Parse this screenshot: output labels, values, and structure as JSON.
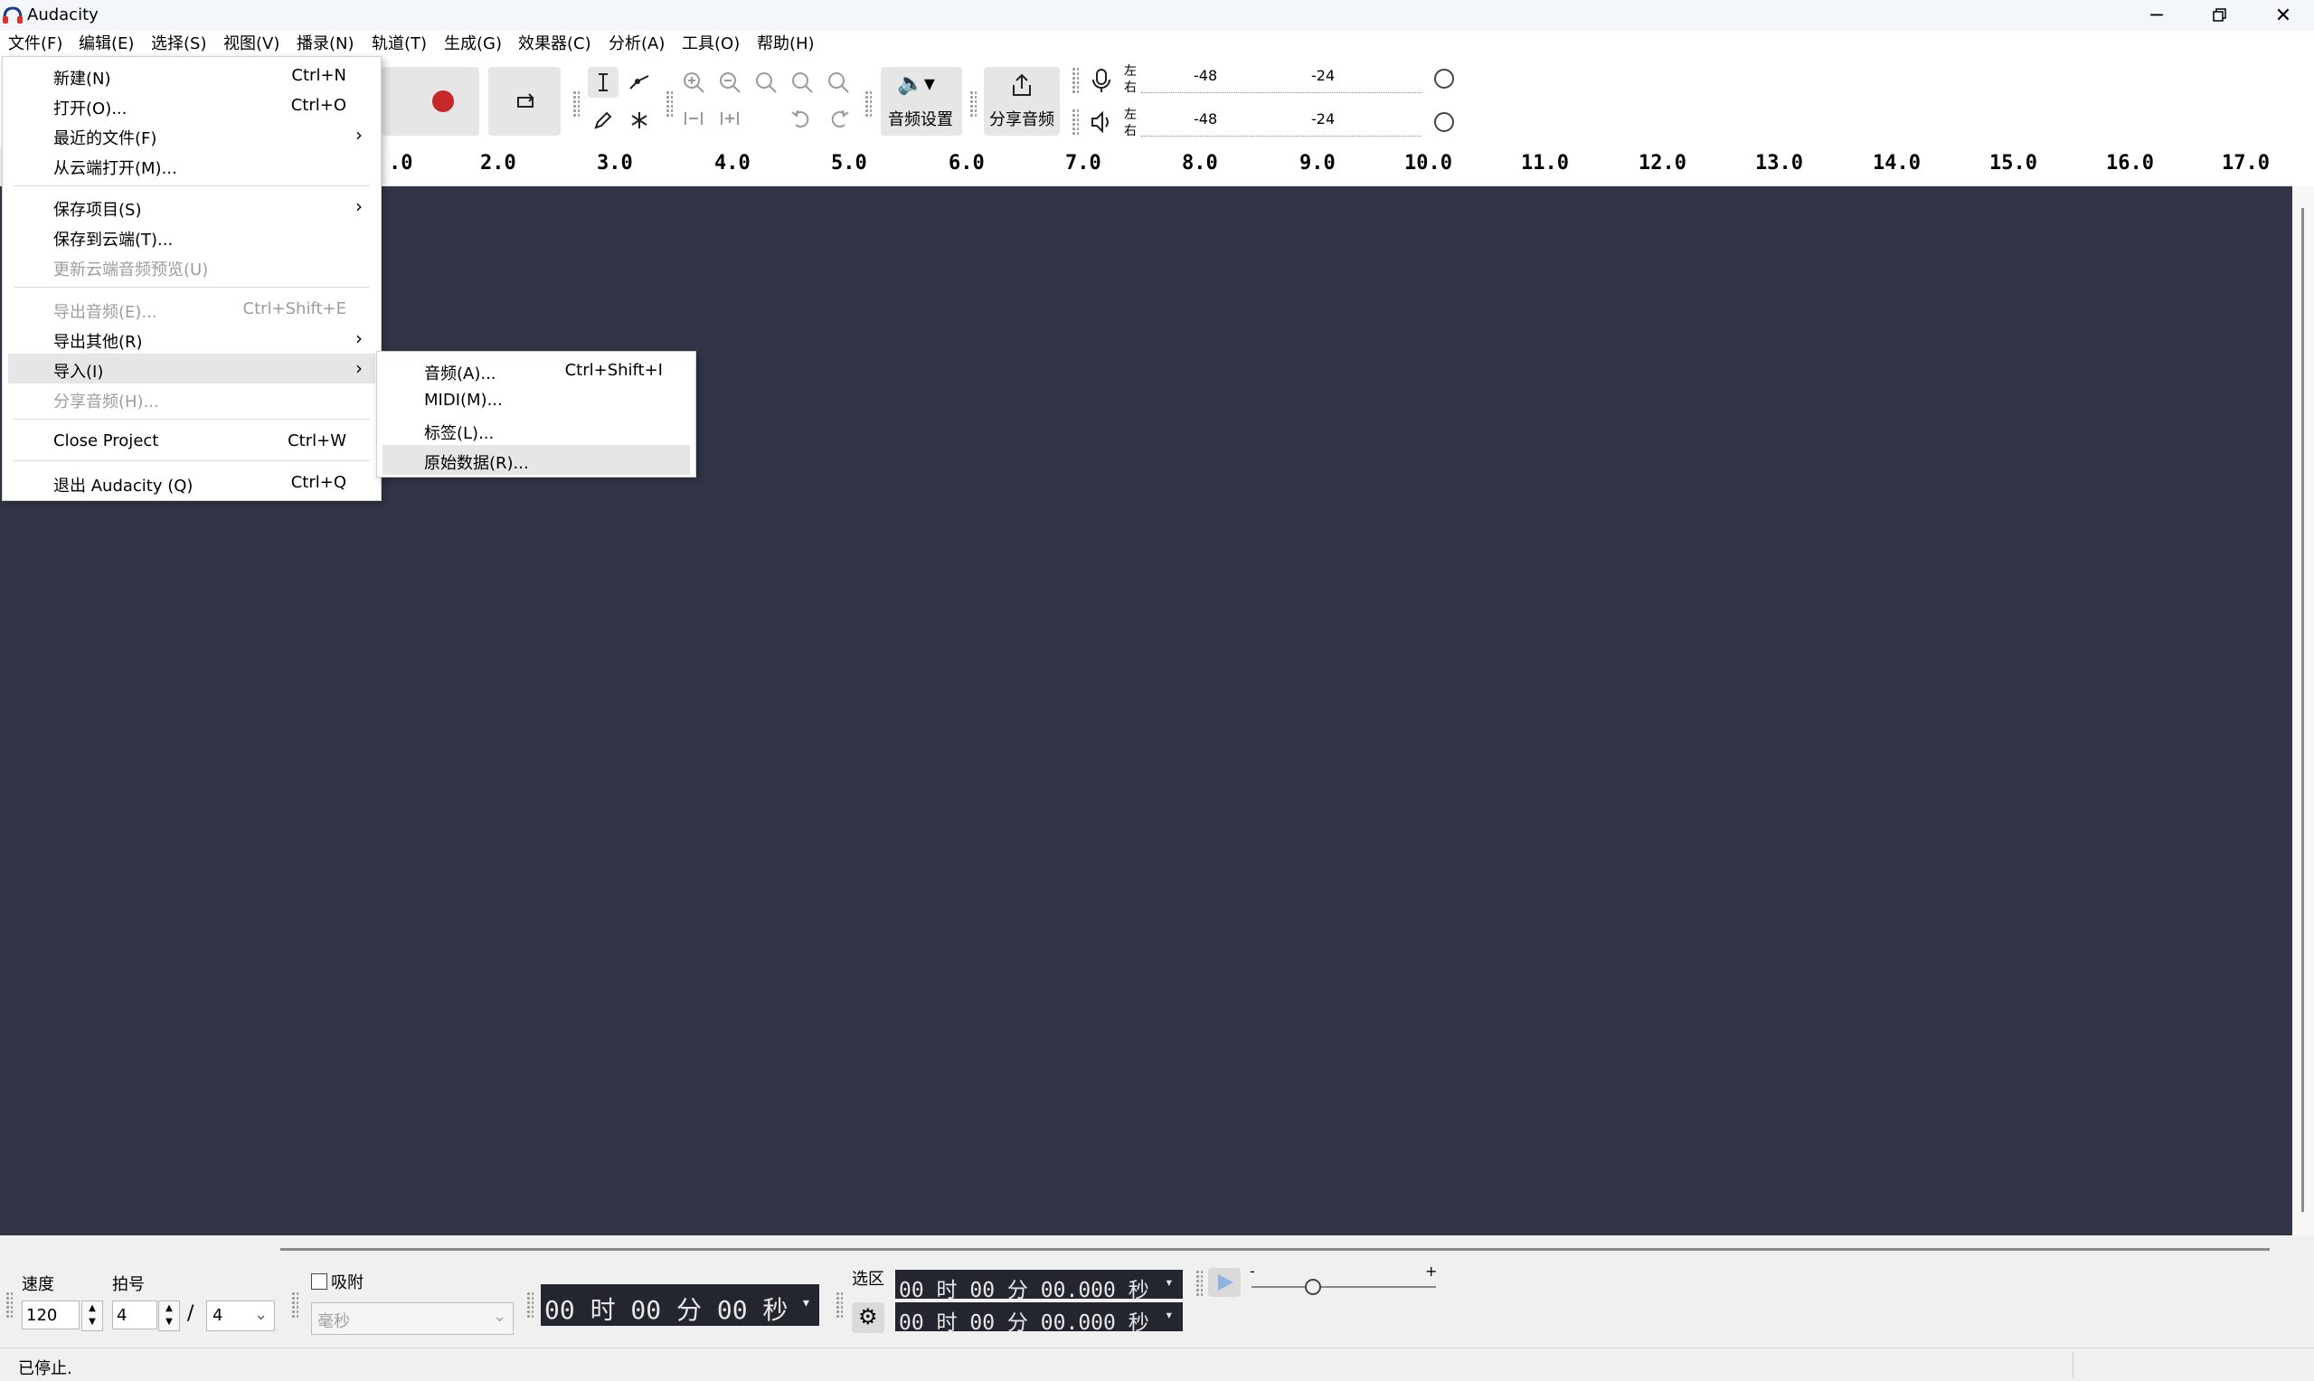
{
  "window": {
    "title": "Audacity"
  },
  "menubar": [
    "文件(F)",
    "编辑(E)",
    "选择(S)",
    "视图(V)",
    "播录(N)",
    "轨道(T)",
    "生成(G)",
    "效果器(C)",
    "分析(A)",
    "工具(O)",
    "帮助(H)"
  ],
  "file_menu": {
    "items": [
      {
        "label": "新建(N)",
        "shortcut": "Ctrl+N"
      },
      {
        "label": "打开(O)...",
        "shortcut": "Ctrl+O"
      },
      {
        "label": "最近的文件(F)",
        "submenu": true
      },
      {
        "label": "从云端打开(M)..."
      },
      {
        "label": "保存项目(S)",
        "submenu": true
      },
      {
        "label": "保存到云端(T)..."
      },
      {
        "label": "更新云端音频预览(U)",
        "disabled": true
      },
      {
        "label": "导出音频(E)...",
        "shortcut": "Ctrl+Shift+E",
        "disabled": true
      },
      {
        "label": "导出其他(R)",
        "submenu": true
      },
      {
        "label": "导入(I)",
        "submenu": true,
        "highlighted": true
      },
      {
        "label": "分享音频(H)...",
        "disabled": true
      },
      {
        "label": "Close Project",
        "shortcut": "Ctrl+W"
      },
      {
        "label": "退出 Audacity (Q)",
        "shortcut": "Ctrl+Q"
      }
    ]
  },
  "import_submenu": {
    "items": [
      {
        "label": "音频(A)...",
        "shortcut": "Ctrl+Shift+I"
      },
      {
        "label": "MIDI(M)..."
      },
      {
        "label": "标签(L)..."
      },
      {
        "label": "原始数据(R)...",
        "highlighted": true
      }
    ]
  },
  "toolbar": {
    "audio_setup_label": "音频设置",
    "share_audio_label": "分享音频",
    "meter_lr": [
      "左",
      "右"
    ],
    "meter_ticks": [
      "-48",
      "-24"
    ]
  },
  "ruler": {
    "ticks": [
      ".0",
      "2.0",
      "3.0",
      "4.0",
      "5.0",
      "6.0",
      "7.0",
      "8.0",
      "9.0",
      "10.0",
      "11.0",
      "12.0",
      "13.0",
      "14.0",
      "15.0",
      "16.0",
      "17.0"
    ]
  },
  "bottom": {
    "tempo_label": "速度",
    "tempo_value": "120",
    "timesig_label": "拍号",
    "timesig_num": "4",
    "timesig_sep": "/",
    "timesig_den": "4",
    "snap_label": "吸附",
    "snap_unit": "毫秒",
    "time_display": "00 时 00 分 00 秒",
    "selection_label": "选区",
    "selection_start": "00 时 00 分 00.000 秒",
    "selection_end": "00 时 00 分 00.000 秒",
    "speed_min": "-",
    "speed_max": "+"
  },
  "status": {
    "text": "已停止."
  },
  "colors": {
    "track_bg": "#323547",
    "record_red": "#c62828",
    "menu_highlight": "#e6e6e6"
  }
}
